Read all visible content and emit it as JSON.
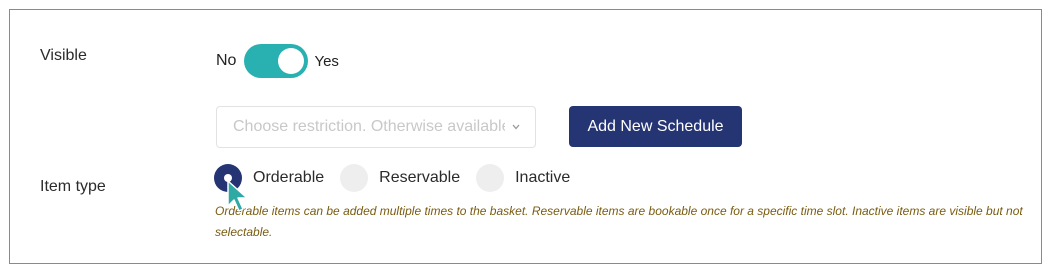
{
  "visible": {
    "label": "Visible",
    "toggle_off_label": "No",
    "toggle_on_label": "Yes",
    "toggle_state": "on"
  },
  "schedule": {
    "select_placeholder": "Choose restriction. Otherwise available",
    "add_button_label": "Add New Schedule"
  },
  "item_type": {
    "label": "Item type",
    "options": [
      {
        "label": "Orderable",
        "checked": true
      },
      {
        "label": "Reservable",
        "checked": false
      },
      {
        "label": "Inactive",
        "checked": false
      }
    ],
    "help_text": "Orderable items can be added multiple times to the basket. Reservable items are bookable once for a specific time slot. Inactive items are visible but not selectable."
  },
  "colors": {
    "toggle_on": "#28b1b0",
    "primary": "#253472",
    "help_text": "#7a5c10",
    "cursor": "#2fa9a4"
  }
}
